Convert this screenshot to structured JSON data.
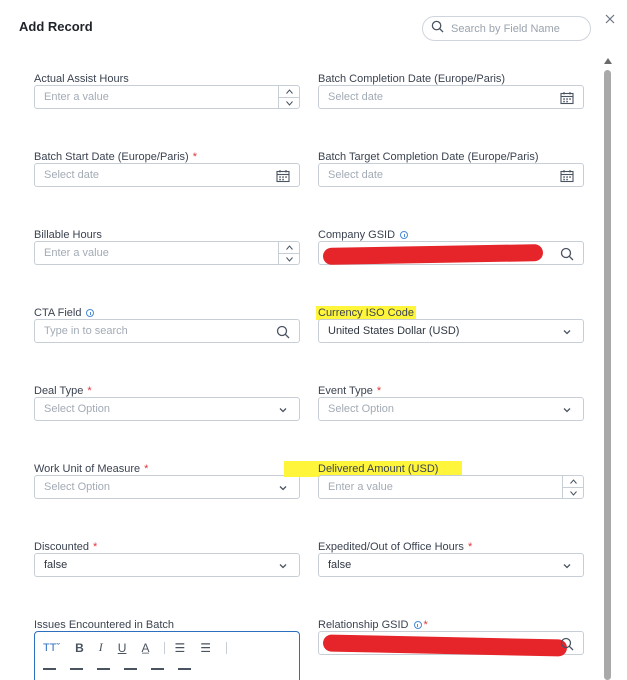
{
  "modal": {
    "title": "Add Record",
    "search_placeholder": "Search by Field Name"
  },
  "fields": {
    "actual_assist_hours": {
      "label": "Actual Assist Hours",
      "placeholder": "Enter a value"
    },
    "batch_completion_date": {
      "label": "Batch Completion Date (Europe/Paris)",
      "placeholder": "Select date"
    },
    "batch_start_date": {
      "label": "Batch Start Date (Europe/Paris)",
      "required": "*",
      "placeholder": "Select date"
    },
    "batch_target_completion_date": {
      "label": "Batch Target Completion Date (Europe/Paris)",
      "placeholder": "Select date"
    },
    "billable_hours": {
      "label": "Billable Hours",
      "placeholder": "Enter a value"
    },
    "company_gsid": {
      "label": "Company GSID"
    },
    "cta_field": {
      "label": "CTA Field",
      "placeholder": "Type in to search"
    },
    "currency_iso_code": {
      "label": "Currency ISO Code",
      "value": "United States Dollar (USD)"
    },
    "deal_type": {
      "label": "Deal Type",
      "required": "*",
      "placeholder": "Select Option"
    },
    "event_type": {
      "label": "Event Type",
      "required": "*",
      "placeholder": "Select Option"
    },
    "work_unit_of_measure": {
      "label": "Work Unit of Measure",
      "required": "*",
      "placeholder": "Select Option"
    },
    "delivered_amount": {
      "label": "Delivered Amount (USD)",
      "placeholder": "Enter a value"
    },
    "discounted": {
      "label": "Discounted",
      "required": "*",
      "value": "false"
    },
    "expedited_hours": {
      "label": "Expedited/Out of Office Hours",
      "required": "*",
      "value": "false"
    },
    "issues_encountered": {
      "label": "Issues Encountered in Batch"
    },
    "relationship_gsid": {
      "label": "Relationship GSID",
      "required": "*"
    }
  },
  "colors": {
    "required": "#e0353b",
    "info": "#4a8ad6",
    "highlight": "#fff53a",
    "redaction": "#e5252a",
    "focus_border": "#2c6fbe"
  },
  "icons": [
    "search-icon",
    "close-icon",
    "calendar-icon",
    "chevron-down-icon",
    "chevron-up-icon",
    "info-icon",
    "bold-icon",
    "italic-icon",
    "underline-icon",
    "text-color-icon",
    "ordered-list-icon",
    "bullet-list-icon",
    "font-size-icon"
  ]
}
